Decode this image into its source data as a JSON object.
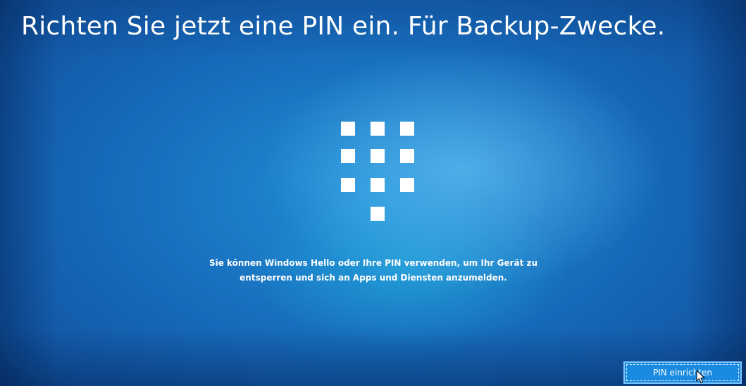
{
  "setup": {
    "title": "Richten Sie jetzt eine PIN ein. Für Backup-Zwecke.",
    "message_line1": "Sie können Windows Hello oder Ihre PIN verwenden, um Ihr Gerät zu",
    "message_line2": "entsperren und sich an Apps und Diensten anzumelden.",
    "keypad_icon": "pin-keypad-icon",
    "button_label": "PIN einrichten",
    "pointer_icon": "mouse-pointer-icon"
  },
  "colors": {
    "background": "#1667b8",
    "button": "#1a8be0",
    "text": "#ffffff"
  }
}
